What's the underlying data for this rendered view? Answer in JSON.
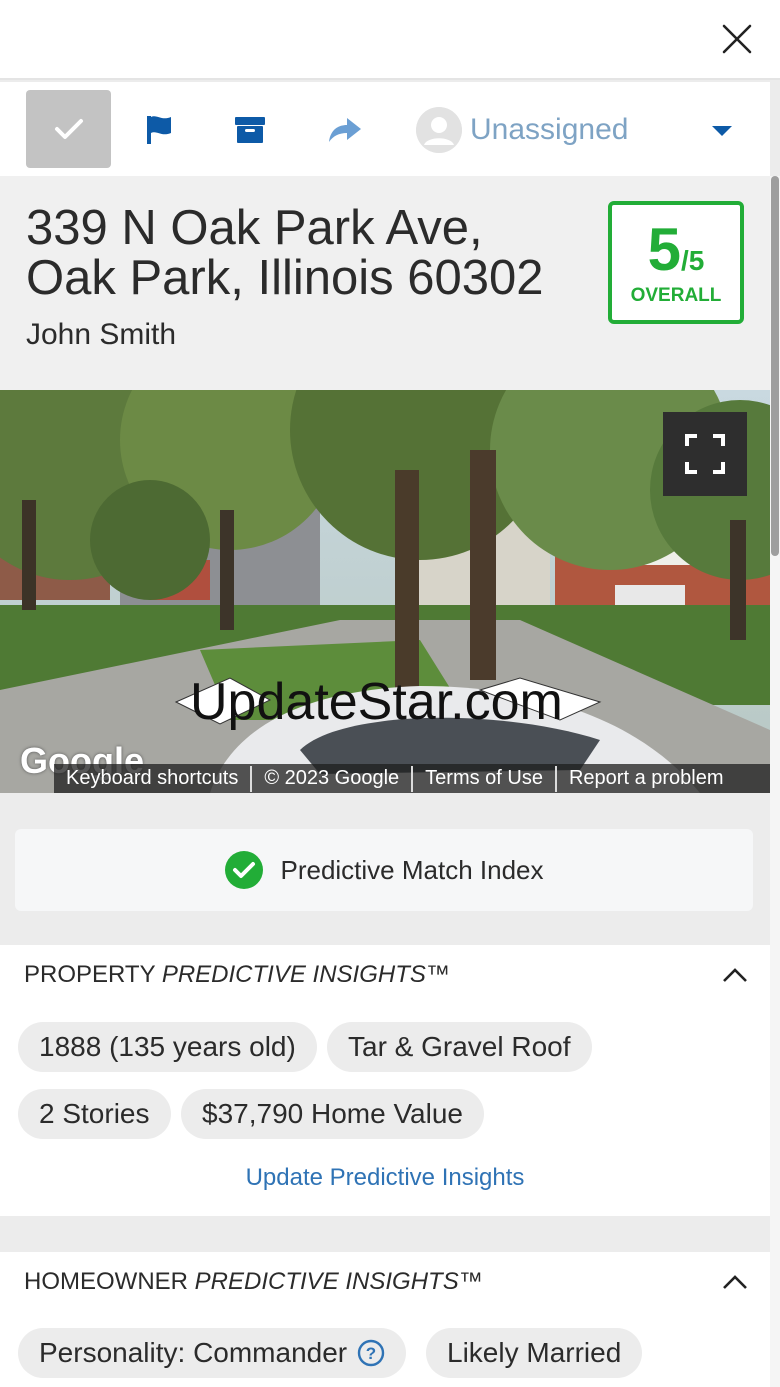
{
  "header": {
    "close_icon": "close-icon"
  },
  "toolbar": {
    "assignee": "Unassigned",
    "colors": {
      "accent": "#0d5aa7",
      "muted_blue": "#7ea3c4",
      "check_bg": "#c3c3c3"
    }
  },
  "property": {
    "address_line1": "339 N Oak Park Ave,",
    "address_line2": "Oak Park, Illinois 60302",
    "owner": "John Smith",
    "score": {
      "value": "5",
      "denominator": "/5",
      "label": "OVERALL",
      "color": "#22ad37"
    }
  },
  "streetview": {
    "footer": [
      "Keyboard shortcuts",
      "© 2023 Google",
      "Terms of Use",
      "Report a problem"
    ],
    "logo_text": "Google",
    "watermark": "UpdateStar.com"
  },
  "match": {
    "label": "Predictive Match Index"
  },
  "property_insights": {
    "title_plain": "PROPERTY ",
    "title_italic": "PREDICTIVE INSIGHTS™",
    "chips": [
      "1888 (135 years old)",
      "Tar & Gravel Roof",
      "2 Stories",
      "$37,790 Home Value"
    ],
    "update_link": "Update Predictive Insights"
  },
  "homeowner_insights": {
    "title_plain": "HOMEOWNER ",
    "title_italic": "PREDICTIVE INSIGHTS™",
    "chips": [
      "Personality: Commander",
      "Likely Married"
    ]
  }
}
